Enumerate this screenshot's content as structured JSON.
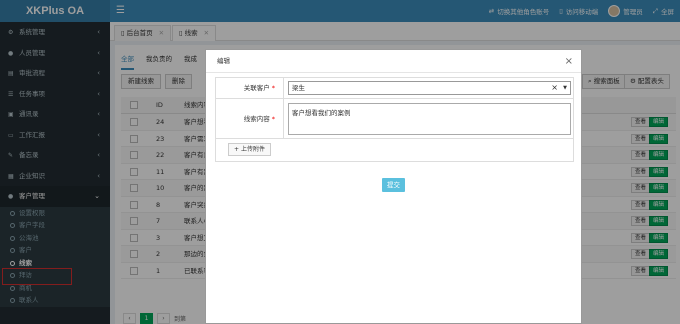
{
  "app": {
    "title": "XKPlus OA"
  },
  "header": {
    "switch_role": "切换其他角色账号",
    "mobile": "访问移动端",
    "user": "管理员",
    "fullscreen": "全屏"
  },
  "sidebar": {
    "items": [
      {
        "label": "系统管理",
        "icon": "gears-icon"
      },
      {
        "label": "人员管理",
        "icon": "user-icon"
      },
      {
        "label": "审批流程",
        "icon": "flow-icon"
      },
      {
        "label": "任务事项",
        "icon": "list-icon"
      },
      {
        "label": "通讯录",
        "icon": "book-icon"
      },
      {
        "label": "工作汇报",
        "icon": "report-icon"
      },
      {
        "label": "备忘录",
        "icon": "memo-icon"
      },
      {
        "label": "企业知识",
        "icon": "knowledge-icon"
      },
      {
        "label": "客户管理",
        "icon": "customer-icon"
      }
    ],
    "sub": [
      {
        "label": "设置权限"
      },
      {
        "label": "客户字段"
      },
      {
        "label": "公海池"
      },
      {
        "label": "客户"
      },
      {
        "label": "线索"
      },
      {
        "label": "拜访"
      },
      {
        "label": "商机"
      },
      {
        "label": "联系人"
      }
    ]
  },
  "tabs": [
    {
      "label": "后台首页"
    },
    {
      "label": "线索"
    }
  ],
  "list": {
    "subtabs": [
      "全部",
      "我负责的",
      "我成"
    ],
    "new_button": "新建线索",
    "delete_button": "删除",
    "search_panel": "搜索面板",
    "config": "配置表头",
    "col_id": "ID",
    "col_content": "线索内容",
    "rows": [
      {
        "id": "24",
        "text": "客户想看我"
      },
      {
        "id": "23",
        "text": "客户需求比"
      },
      {
        "id": "22",
        "text": "客户有意向"
      },
      {
        "id": "11",
        "text": "客户有需求"
      },
      {
        "id": "10",
        "text": "客户的需求"
      },
      {
        "id": "8",
        "text": "客户突然改"
      },
      {
        "id": "7",
        "text": "联系人小白"
      },
      {
        "id": "3",
        "text": "客户想又要"
      },
      {
        "id": "2",
        "text": "那边的负责"
      },
      {
        "id": "1",
        "text": "已联系客户"
      }
    ],
    "view_label": "查看",
    "edit_label": "编辑",
    "page": "1",
    "goto": "到第"
  },
  "modal": {
    "title": "编辑",
    "customer_label": "关联客户",
    "customer_value": "梁生",
    "content_label": "线索内容",
    "content_value": "客户想看我们的案例",
    "upload_label": "上传附件",
    "submit_label": "提交"
  }
}
